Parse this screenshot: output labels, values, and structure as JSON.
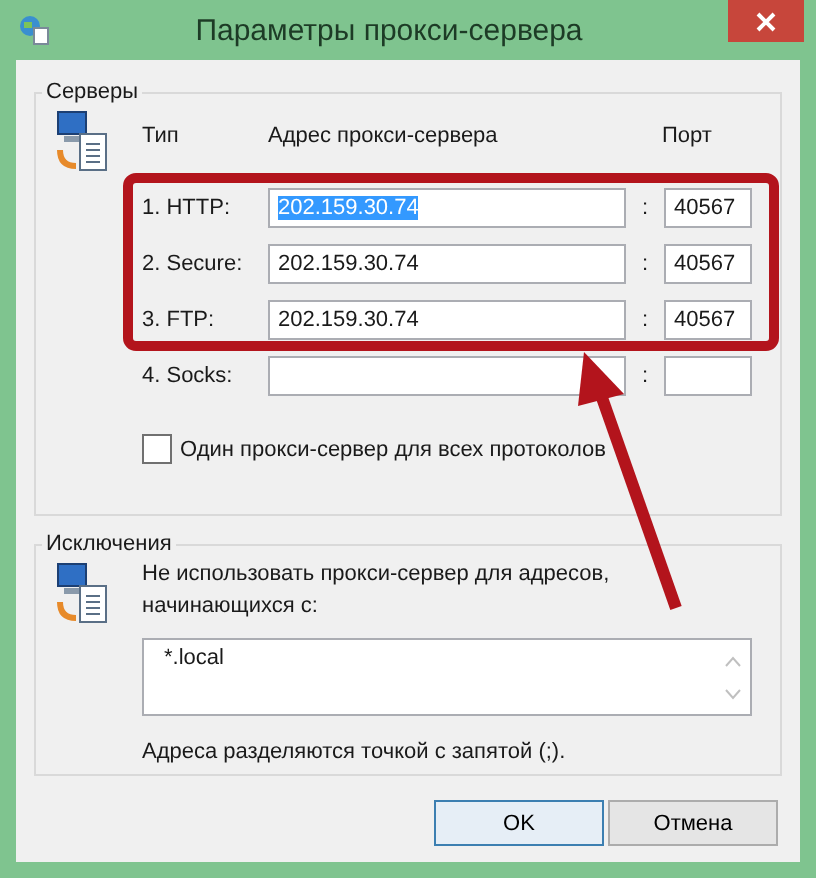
{
  "window": {
    "title": "Параметры прокси-сервера"
  },
  "servers": {
    "label": "Серверы",
    "headers": [
      "Тип",
      "Адрес прокси-сервера",
      "Порт"
    ],
    "rows": [
      {
        "label": "1. HTTP:",
        "address": "202.159.30.74",
        "separator": ":",
        "port": "40567",
        "text_selected": true
      },
      {
        "label": "2. Secure:",
        "address": "202.159.30.74",
        "separator": ":",
        "port": "40567",
        "text_selected": false
      },
      {
        "label": "3. FTP:",
        "address": "202.159.30.74",
        "separator": ":",
        "port": "40567",
        "text_selected": false
      },
      {
        "label": "4. Socks:",
        "separator": ":"
      }
    ],
    "same_proxy": {
      "label": "Один прокси-сервер для всех протоколов",
      "checked": false
    }
  },
  "exceptions": {
    "label": "Исключения",
    "description": "Не использовать прокси-сервер для адресов, начинающихся с:",
    "value": "*.local",
    "note": "Адреса разделяются точкой с запятой (;)."
  },
  "buttons": [
    {
      "label": "OK",
      "default": true
    },
    {
      "label": "Отмена",
      "default": false
    }
  ]
}
